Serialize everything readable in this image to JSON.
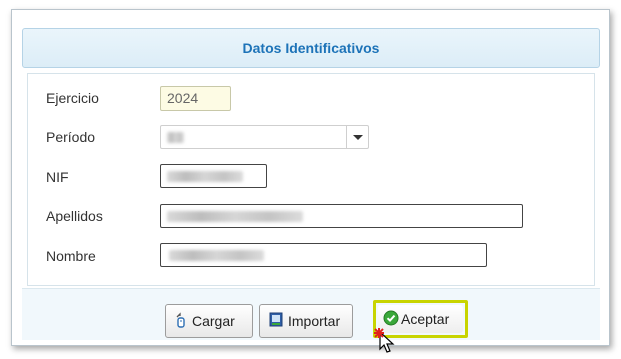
{
  "dialog": {
    "title": "Datos Identificativos"
  },
  "form": {
    "ejercicio": {
      "label": "Ejercicio",
      "value": "2024"
    },
    "periodo": {
      "label": "Período",
      "value": ""
    },
    "nif": {
      "label": "NIF",
      "value": ""
    },
    "apellidos": {
      "label": "Apellidos",
      "value": ""
    },
    "nombre": {
      "label": "Nombre",
      "value": ""
    }
  },
  "buttons": {
    "cargar": {
      "label": "Cargar",
      "icon": "upload-icon"
    },
    "importar": {
      "label": "Importar",
      "icon": "import-icon"
    },
    "aceptar": {
      "label": "Aceptar",
      "icon": "check-circle-icon"
    }
  },
  "colors": {
    "title": "#1d73b8",
    "highlight": "#c8d400",
    "accept_icon": "#3aa83a"
  }
}
